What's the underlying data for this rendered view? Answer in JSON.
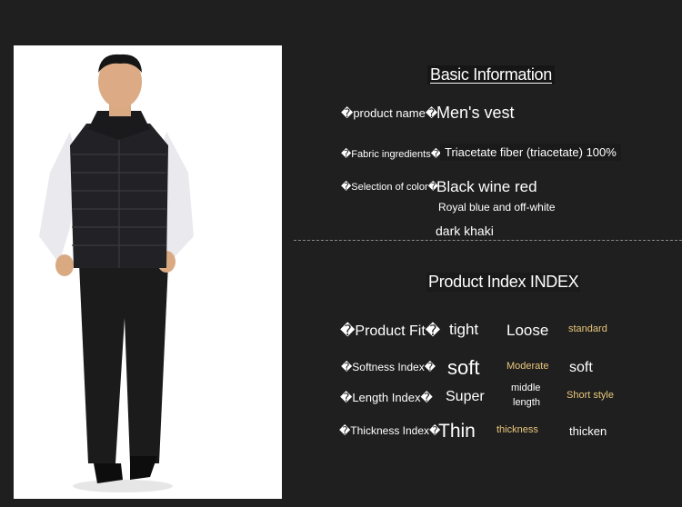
{
  "basic": {
    "title": "Basic Information",
    "product_name_label": "�product name�",
    "product_name_value": "Men's vest",
    "fabric_label": "�Fabric ingredients�",
    "fabric_value": "Triacetate fiber (triacetate) 100%",
    "color_label": "�Selection of color�",
    "color_value_1": "Black wine red",
    "color_value_2": "Royal blue and off-white",
    "color_value_3": "dark khaki"
  },
  "index": {
    "title": "Product Index INDEX",
    "fit": {
      "label": "�Product Fit�",
      "opt1": "tight",
      "opt2": "Loose",
      "opt3": "standard"
    },
    "softness": {
      "label": "�Softness Index�",
      "opt1": "soft",
      "opt2": "Moderate",
      "opt3": "soft"
    },
    "length": {
      "label": "�Length Index�",
      "opt1": "Super",
      "opt2a": "middle",
      "opt2b": "length",
      "opt3": "Short style"
    },
    "thickness": {
      "label": "�Thickness Index�",
      "opt1": "Thin",
      "opt2": "thickness",
      "opt3": "thicken"
    }
  },
  "colors": {
    "background": "#1f1f1f",
    "accent_gold": "#e8c77c"
  }
}
